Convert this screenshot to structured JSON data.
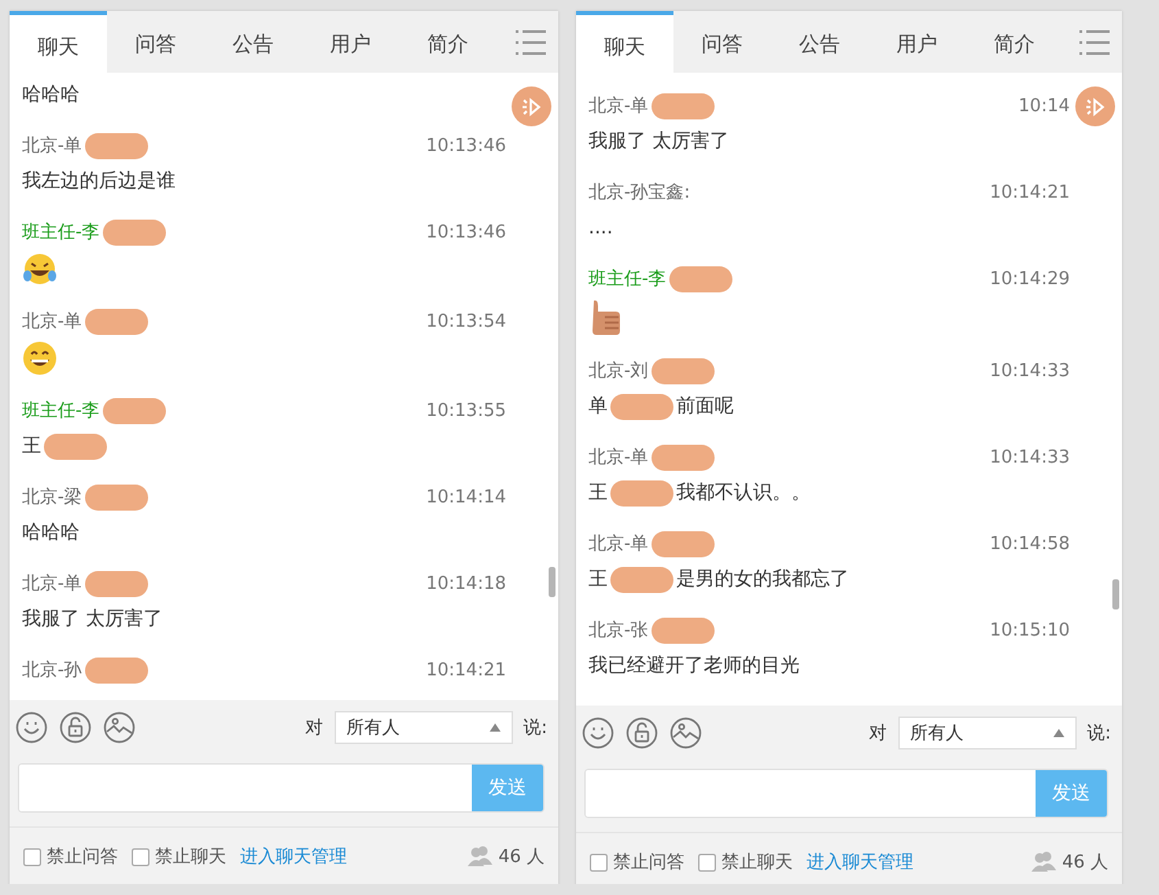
{
  "panels": [
    {
      "tabs": [
        {
          "label": "聊天",
          "selected": true
        },
        {
          "label": "问答",
          "selected": false
        },
        {
          "label": "公告",
          "selected": false
        },
        {
          "label": "用户",
          "selected": false
        },
        {
          "label": "简介",
          "selected": false
        }
      ],
      "messages": [
        {
          "content": [
            {
              "kind": "text",
              "text": "哈哈哈"
            }
          ]
        },
        {
          "sender": {
            "text": "北京-单",
            "redacted": true,
            "color": "#666666"
          },
          "time": "10:13:46",
          "content": [
            {
              "kind": "text",
              "text": "我左边的后边是谁"
            }
          ]
        },
        {
          "sender": {
            "text": "班主任-李",
            "redacted": true,
            "color": "#1a9c1a"
          },
          "time": "10:13:46",
          "content": [
            {
              "kind": "laugh"
            }
          ]
        },
        {
          "sender": {
            "text": "北京-单",
            "redacted": true,
            "color": "#666666"
          },
          "time": "10:13:54",
          "content": [
            {
              "kind": "grin"
            }
          ]
        },
        {
          "sender": {
            "text": "班主任-李",
            "redacted": true,
            "color": "#1a9c1a"
          },
          "time": "10:13:55",
          "content": [
            {
              "kind": "text",
              "text": "王"
            },
            {
              "kind": "redaction"
            }
          ]
        },
        {
          "sender": {
            "text": "北京-梁",
            "redacted": true,
            "color": "#666666"
          },
          "time": "10:14:14",
          "content": [
            {
              "kind": "text",
              "text": "哈哈哈"
            }
          ]
        },
        {
          "sender": {
            "text": "北京-单",
            "redacted": true,
            "color": "#666666"
          },
          "time": "10:14:18",
          "content": [
            {
              "kind": "text",
              "text": "我服了 太厉害了"
            }
          ]
        },
        {
          "sender": {
            "text": "北京-孙",
            "redacted": true,
            "color": "#666666"
          },
          "time": "10:14:21"
        }
      ],
      "compose": {
        "to_label": "对",
        "recipient": "所有人",
        "say_label": "说:",
        "send": "发送"
      },
      "footer": {
        "options": [
          {
            "label": "禁止问答",
            "checked": false
          },
          {
            "label": "禁止聊天",
            "checked": false
          }
        ],
        "manage_link": "进入聊天管理",
        "online_count": "46 人"
      }
    },
    {
      "tabs": [
        {
          "label": "聊天",
          "selected": true
        },
        {
          "label": "问答",
          "selected": false
        },
        {
          "label": "公告",
          "selected": false
        },
        {
          "label": "用户",
          "selected": false
        },
        {
          "label": "简介",
          "selected": false
        }
      ],
      "messages": [
        {
          "sender": {
            "text": "北京-单",
            "redacted": true,
            "color": "#666666"
          },
          "time": "10:14",
          "content": [
            {
              "kind": "text",
              "text": "我服了 太厉害了"
            }
          ]
        },
        {
          "sender": {
            "text": "北京-孙宝鑫:",
            "redacted": false,
            "color": "#666666"
          },
          "time": "10:14:21",
          "content": [
            {
              "kind": "text",
              "text": "...."
            }
          ]
        },
        {
          "sender": {
            "text": "班主任-李",
            "redacted": true,
            "color": "#1a9c1a"
          },
          "time": "10:14:29",
          "content": [
            {
              "kind": "thumb"
            }
          ]
        },
        {
          "sender": {
            "text": "北京-刘",
            "redacted": true,
            "color": "#666666"
          },
          "time": "10:14:33",
          "content": [
            {
              "kind": "text",
              "text": "单"
            },
            {
              "kind": "redaction"
            },
            {
              "kind": "text",
              "text": "前面呢"
            }
          ]
        },
        {
          "sender": {
            "text": "北京-单",
            "redacted": true,
            "color": "#666666"
          },
          "time": "10:14:33",
          "content": [
            {
              "kind": "text",
              "text": "王"
            },
            {
              "kind": "redaction"
            },
            {
              "kind": "text",
              "text": "我都不认识。。"
            }
          ]
        },
        {
          "sender": {
            "text": "北京-单",
            "redacted": true,
            "color": "#666666"
          },
          "time": "10:14:58",
          "content": [
            {
              "kind": "text",
              "text": "王"
            },
            {
              "kind": "redaction"
            },
            {
              "kind": "text",
              "text": "是男的女的我都忘了"
            }
          ]
        },
        {
          "sender": {
            "text": "北京-张",
            "redacted": true,
            "color": "#666666"
          },
          "time": "10:15:10",
          "content": [
            {
              "kind": "text",
              "text": "我已经避开了老师的目光"
            }
          ]
        }
      ],
      "compose": {
        "to_label": "对",
        "recipient": "所有人",
        "say_label": "说:",
        "send": "发送"
      },
      "footer": {
        "options": [
          {
            "label": "禁止问答",
            "checked": false
          },
          {
            "label": "禁止聊天",
            "checked": false
          }
        ],
        "manage_link": "进入聊天管理",
        "online_count": "46 人"
      }
    }
  ]
}
